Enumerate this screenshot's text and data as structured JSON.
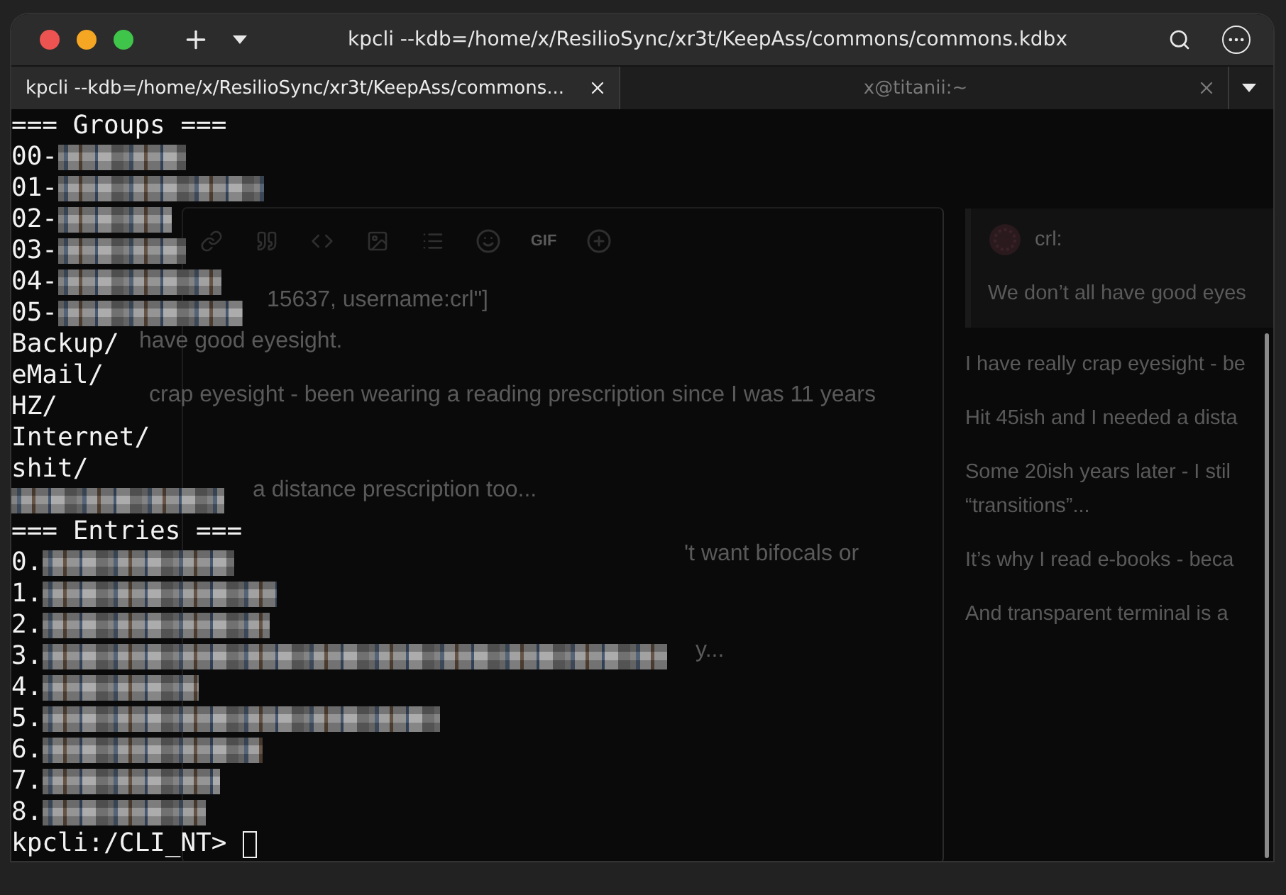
{
  "window": {
    "title": "kpcli --kdb=/home/x/ResilioSync/xr3t/KeepAss/commons/commons.kdbx"
  },
  "tabs": [
    {
      "label": "kpcli --kdb=/home/x/ResilioSync/xr3t/KeepAss/commons...",
      "selected": true
    },
    {
      "label": "x@titanii:~",
      "selected": false
    }
  ],
  "background": {
    "editor": {
      "toolbar_label": "GIF",
      "lines": [
        "15637, username:crl\"]",
        "have good eyesight.",
        "crap eyesight - been wearing a reading prescription since I was 11 years",
        "a distance prescription too...",
        "'t want bifocals or",
        "y..."
      ]
    },
    "reply_preview": {
      "quote": {
        "author": "crl:",
        "text": "We don’t all have good eyes"
      },
      "paragraphs": [
        "I have really crap eyesight - be",
        "Hit 45ish and I needed a dista",
        "Some 20ish years later - I stil\n“transitions”...",
        "It’s why I read e-books - beca",
        "And transparent terminal is a"
      ]
    }
  },
  "terminal": {
    "lines": [
      {
        "text": "=== Groups ===",
        "redacted": false
      },
      {
        "text": "00-",
        "redacted": true
      },
      {
        "text": "01-",
        "redacted": true
      },
      {
        "text": "02-",
        "redacted": true
      },
      {
        "text": "03-",
        "redacted": true
      },
      {
        "text": "04-",
        "redacted": true
      },
      {
        "text": "05-",
        "redacted": true
      },
      {
        "text": "Backup/",
        "redacted": false
      },
      {
        "text": "eMail/",
        "redacted": false
      },
      {
        "text": "HZ/",
        "redacted": false
      },
      {
        "text": "Internet/",
        "redacted": false
      },
      {
        "text": "shit/",
        "redacted": false
      },
      {
        "redacted": true
      },
      {
        "text": "=== Entries ===",
        "redacted": false
      },
      {
        "text": "0.",
        "redacted": true
      },
      {
        "text": "1.",
        "redacted": true
      },
      {
        "text": "2.",
        "redacted": true
      },
      {
        "text": "3.",
        "redacted": true
      },
      {
        "text": "4.",
        "redacted": true
      },
      {
        "text": "5.",
        "redacted": true
      },
      {
        "text": "6.",
        "redacted": true
      },
      {
        "text": "7.",
        "redacted": true
      },
      {
        "text": "8.",
        "redacted": true
      }
    ],
    "prompt": "kpcli:/CLI_NT>"
  }
}
